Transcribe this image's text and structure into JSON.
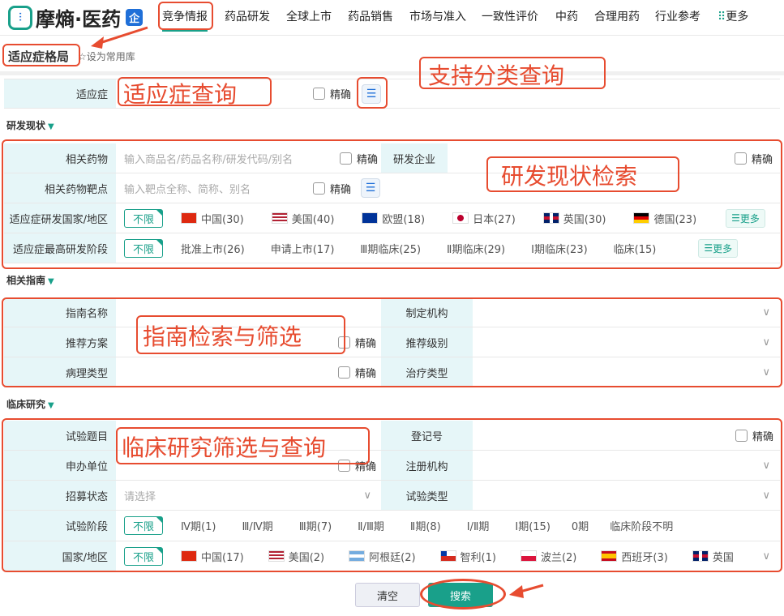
{
  "brand": {
    "name": "摩熵·医药",
    "badge": "企"
  },
  "nav": {
    "tabs": [
      "竞争情报",
      "药品研发",
      "全球上市",
      "药品销售",
      "市场与准入",
      "一致性评价",
      "中药",
      "合理用药",
      "行业参考"
    ],
    "more": "更多"
  },
  "page": {
    "title": "适应症格局",
    "favorite": "设为常用库"
  },
  "indication": {
    "label": "适应症",
    "precise": "精确"
  },
  "rd": {
    "section": "研发现状",
    "drug_label": "相关药物",
    "drug_placeholder": "输入商品名/药品名称/研发代码/别名",
    "precise": "精确",
    "company_label": "研发企业",
    "target_label": "相关药物靶点",
    "target_placeholder": "输入靶点全称、简称、别名",
    "country_label": "适应症研发国家/地区",
    "unlimited": "不限",
    "countries": [
      "中国(30)",
      "美国(40)",
      "欧盟(18)",
      "日本(27)",
      "英国(30)",
      "德国(23)"
    ],
    "stage_label": "适应症最高研发阶段",
    "stages": [
      "批准上市(26)",
      "申请上市(17)",
      "Ⅲ期临床(25)",
      "Ⅱ期临床(29)",
      "Ⅰ期临床(23)",
      "临床(15)"
    ],
    "more": "更多"
  },
  "guide": {
    "section": "相关指南",
    "name": "指南名称",
    "org": "制定机构",
    "plan": "推荐方案",
    "level": "推荐级别",
    "pathology": "病理类型",
    "therapy": "治疗类型",
    "precise": "精确"
  },
  "clinical": {
    "section": "临床研究",
    "topic": "试验题目",
    "reg_no": "登记号",
    "sponsor": "申办单位",
    "reg_org": "注册机构",
    "recruit": "招募状态",
    "recruit_placeholder": "请选择",
    "type": "试验类型",
    "phase_label": "试验阶段",
    "unlimited": "不限",
    "precise": "精确",
    "phases": [
      "Ⅳ期(1)",
      "Ⅲ/Ⅳ期",
      "Ⅲ期(7)",
      "Ⅱ/Ⅲ期",
      "Ⅱ期(8)",
      "Ⅰ/Ⅱ期",
      "Ⅰ期(15)",
      "0期",
      "临床阶段不明"
    ],
    "country_label": "国家/地区",
    "countries": [
      "中国(17)",
      "美国(2)",
      "阿根廷(2)",
      "智利(1)",
      "波兰(2)",
      "西班牙(3)",
      "英国"
    ]
  },
  "buttons": {
    "clear": "清空",
    "search": "搜索"
  },
  "annotations": {
    "indication": "适应症查询",
    "category": "支持分类查询",
    "rd": "研发现状检索",
    "guide": "指南检索与筛选",
    "clinical": "临床研究筛选与查询"
  },
  "colors": {
    "accent": "#19a08a",
    "annotation": "#e74c30"
  }
}
